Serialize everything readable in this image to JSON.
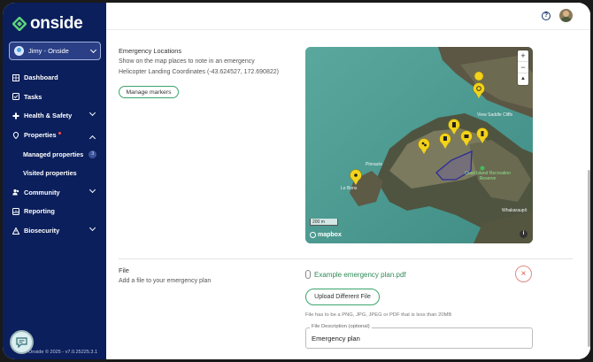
{
  "app": {
    "name": "onside"
  },
  "user_select": {
    "label": "Jimy - Onside"
  },
  "sidebar": {
    "items": [
      {
        "label": "Dashboard",
        "icon": "dashboard-icon"
      },
      {
        "label": "Tasks",
        "icon": "tasks-icon"
      },
      {
        "label": "Health & Safety",
        "icon": "health-safety-icon"
      },
      {
        "label": "Properties",
        "icon": "properties-icon"
      },
      {
        "label": "Community",
        "icon": "community-icon"
      },
      {
        "label": "Reporting",
        "icon": "reporting-icon"
      },
      {
        "label": "Biosecurity",
        "icon": "biosecurity-icon"
      }
    ],
    "subitems": [
      {
        "label": "Managed properties",
        "badge": "3"
      },
      {
        "label": "Visited properties"
      }
    ],
    "footer": "Onside © 2025 - v7.0.25225.3.1"
  },
  "header": {
    "help_icon": "help-circle-icon",
    "avatar": "user-avatar"
  },
  "emergency": {
    "title": "Emergency Locations",
    "desc": "Show on the map places to note in an emergency",
    "coords": "Helicopter Landing Coordinates (-43.624527, 172.690822)",
    "manage_label": "Manage markers"
  },
  "map": {
    "zoom_in": "+",
    "zoom_out": "−",
    "compass": "▲",
    "scale": "200 m",
    "attribution": "mapbox",
    "info": "i",
    "labels": {
      "view_saddle": "View Saddle Cliffs",
      "quail_island": "Quail Island Recreation Reserve",
      "the_pinnacle": "Pinnacle",
      "le_bons": "Le Bons",
      "whakaraupo": "Whakaraupō"
    }
  },
  "file": {
    "title": "File",
    "desc": "Add a file to your emergency plan",
    "filename": "Example emergency plan.pdf",
    "remove": "×",
    "upload_label": "Upload Different File",
    "hint": "File has to be a PNG, JPG, JPEG or PDF that is less than 20MB",
    "desc_label": "File Description (optional)",
    "desc_value": "Emergency plan"
  },
  "colors": {
    "sidebar": "#0b1f5c",
    "accent": "#3aa56a",
    "marker": "#f2d21b"
  }
}
